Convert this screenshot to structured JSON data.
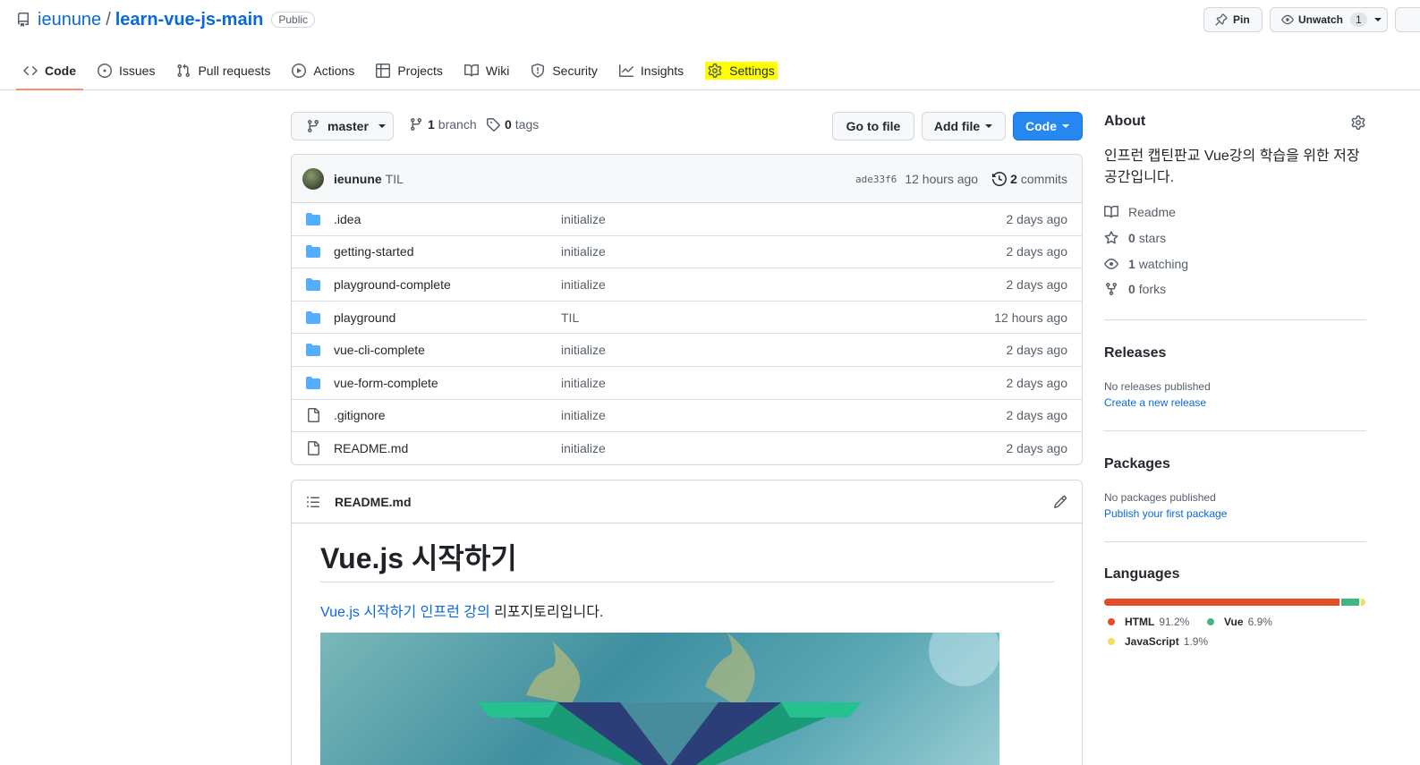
{
  "repo": {
    "owner": "ieunune",
    "separator": "/",
    "name": "learn-vue-js-main",
    "visibility": "Public"
  },
  "header_actions": {
    "pin_label": "Pin",
    "unwatch_label": "Unwatch",
    "unwatch_count": "1"
  },
  "tabs": [
    {
      "label": "Code",
      "icon": "code-icon",
      "active": true
    },
    {
      "label": "Issues",
      "icon": "issue-opened-icon"
    },
    {
      "label": "Pull requests",
      "icon": "git-pull-request-icon"
    },
    {
      "label": "Actions",
      "icon": "play-icon"
    },
    {
      "label": "Projects",
      "icon": "table-icon"
    },
    {
      "label": "Wiki",
      "icon": "book-icon"
    },
    {
      "label": "Security",
      "icon": "shield-icon"
    },
    {
      "label": "Insights",
      "icon": "graph-icon"
    },
    {
      "label": "Settings",
      "icon": "gear-icon",
      "highlighted": true
    }
  ],
  "filenav": {
    "branch": "master",
    "branch_count": "1",
    "branch_word": "branch",
    "tag_count": "0",
    "tag_word": "tags",
    "go_to_file": "Go to file",
    "add_file": "Add file",
    "code": "Code"
  },
  "latest_commit": {
    "author": "ieunune",
    "message": "TIL",
    "sha": "ade33f6",
    "time": "12 hours ago",
    "count": "2",
    "count_word": "commits"
  },
  "files": [
    {
      "type": "dir",
      "name": ".idea",
      "message": "initialize",
      "time": "2 days ago"
    },
    {
      "type": "dir",
      "name": "getting-started",
      "message": "initialize",
      "time": "2 days ago"
    },
    {
      "type": "dir",
      "name": "playground-complete",
      "message": "initialize",
      "time": "2 days ago"
    },
    {
      "type": "dir",
      "name": "playground",
      "message": "TIL",
      "time": "12 hours ago"
    },
    {
      "type": "dir",
      "name": "vue-cli-complete",
      "message": "initialize",
      "time": "2 days ago"
    },
    {
      "type": "dir",
      "name": "vue-form-complete",
      "message": "initialize",
      "time": "2 days ago"
    },
    {
      "type": "file",
      "name": ".gitignore",
      "message": "initialize",
      "time": "2 days ago"
    },
    {
      "type": "file",
      "name": "README.md",
      "message": "initialize",
      "time": "2 days ago"
    }
  ],
  "readme": {
    "filename": "README.md",
    "heading": "Vue.js 시작하기",
    "link_text": "Vue.js 시작하기 인프런 강의",
    "rest_text": " 리포지토리입니다."
  },
  "about": {
    "title": "About",
    "description": "인프런 캡틴판교 Vue강의 학습을 위한 저장 공간입니다.",
    "readme_label": "Readme",
    "stars_count": "0",
    "stars_word": "stars",
    "watching_count": "1",
    "watching_word": "watching",
    "forks_count": "0",
    "forks_word": "forks"
  },
  "releases": {
    "title": "Releases",
    "empty_text": "No releases published",
    "link": "Create a new release"
  },
  "packages": {
    "title": "Packages",
    "empty_text": "No packages published",
    "link": "Publish your first package"
  },
  "languages": {
    "title": "Languages",
    "items": [
      {
        "name": "HTML",
        "percent": "91.2%",
        "value": 91.2,
        "color": "#e34c26"
      },
      {
        "name": "Vue",
        "percent": "6.9%",
        "value": 6.9,
        "color": "#41b883"
      },
      {
        "name": "JavaScript",
        "percent": "1.9%",
        "value": 1.9,
        "color": "#f1e05a"
      }
    ]
  },
  "colors": {
    "link": "#0969da",
    "code_button": "#2587f2",
    "tab_underline": "#fd8c73",
    "highlight": "#ffff00",
    "folder": "#54aeff"
  }
}
